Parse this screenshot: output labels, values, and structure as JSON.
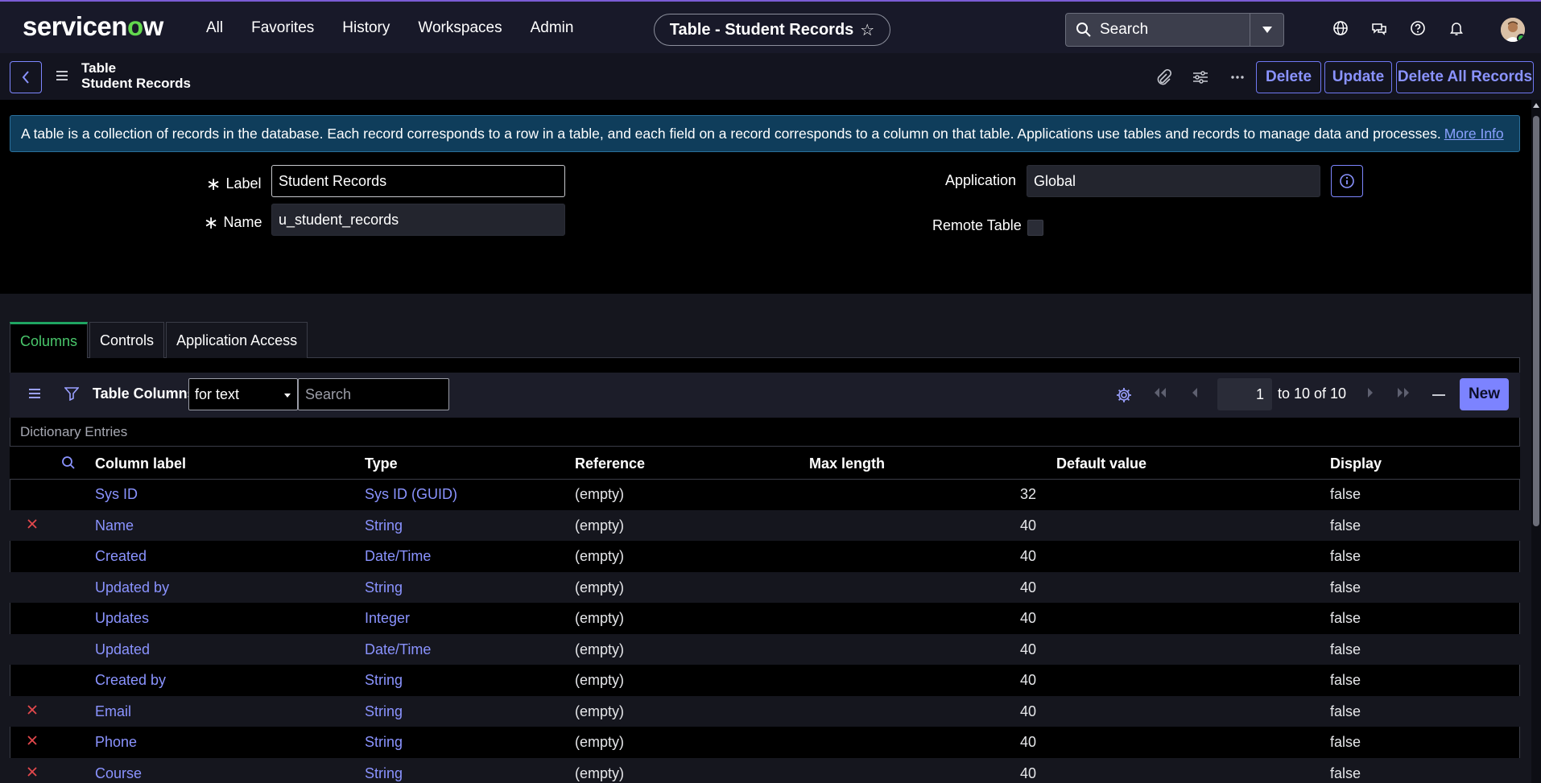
{
  "header": {
    "logo_pre": "servicen",
    "logo_o": "o",
    "logo_post": "w",
    "nav": [
      "All",
      "Favorites",
      "History",
      "Workspaces",
      "Admin"
    ],
    "page_title": "Table - Student Records",
    "search_placeholder": "Search"
  },
  "subheader": {
    "title_line1": "Table",
    "title_line2": "Student Records",
    "buttons": {
      "delete": "Delete",
      "update": "Update",
      "delete_all": "Delete All Records"
    }
  },
  "info": {
    "text": "A table is a collection of records in the database. Each record corresponds to a row in a table, and each field on a record corresponds to a column on that table. Applications use tables and records to manage data and processes.",
    "link": "More Info"
  },
  "form": {
    "label_label": "Label",
    "label_value": "Student Records",
    "name_label": "Name",
    "name_value": "u_student_records",
    "application_label": "Application",
    "application_value": "Global",
    "remote_label": "Remote Table",
    "required_mark": "∗"
  },
  "tabs": [
    "Columns",
    "Controls",
    "Application Access"
  ],
  "list": {
    "title": "Table Columns",
    "filter_value": "for text",
    "search_placeholder": "Search",
    "page_value": "1",
    "page_text": "to 10 of 10",
    "new_label": "New",
    "dictionary_label": "Dictionary Entries",
    "columns": [
      "Column label",
      "Type",
      "Reference",
      "Max length",
      "Default value",
      "Display"
    ],
    "rows": [
      {
        "removable": false,
        "label": "Sys ID",
        "type": "Sys ID (GUID)",
        "reference": "(empty)",
        "max_length": "32",
        "default_value": "",
        "display": "false"
      },
      {
        "removable": true,
        "label": "Name",
        "type": "String",
        "reference": "(empty)",
        "max_length": "40",
        "default_value": "",
        "display": "false"
      },
      {
        "removable": false,
        "label": "Created",
        "type": "Date/Time",
        "reference": "(empty)",
        "max_length": "40",
        "default_value": "",
        "display": "false"
      },
      {
        "removable": false,
        "label": "Updated by",
        "type": "String",
        "reference": "(empty)",
        "max_length": "40",
        "default_value": "",
        "display": "false"
      },
      {
        "removable": false,
        "label": "Updates",
        "type": "Integer",
        "reference": "(empty)",
        "max_length": "40",
        "default_value": "",
        "display": "false"
      },
      {
        "removable": false,
        "label": "Updated",
        "type": "Date/Time",
        "reference": "(empty)",
        "max_length": "40",
        "default_value": "",
        "display": "false"
      },
      {
        "removable": false,
        "label": "Created by",
        "type": "String",
        "reference": "(empty)",
        "max_length": "40",
        "default_value": "",
        "display": "false"
      },
      {
        "removable": true,
        "label": "Email",
        "type": "String",
        "reference": "(empty)",
        "max_length": "40",
        "default_value": "",
        "display": "false"
      },
      {
        "removable": true,
        "label": "Phone",
        "type": "String",
        "reference": "(empty)",
        "max_length": "40",
        "default_value": "",
        "display": "false"
      },
      {
        "removable": true,
        "label": "Course",
        "type": "String",
        "reference": "(empty)",
        "max_length": "40",
        "default_value": "",
        "display": "false"
      }
    ]
  },
  "colors": {
    "accent": "#7c83ff",
    "link": "#8a93ff",
    "tab_active": "#49c76b",
    "delete_mark": "#e5484d",
    "info_bg": "#0f3d5b"
  }
}
